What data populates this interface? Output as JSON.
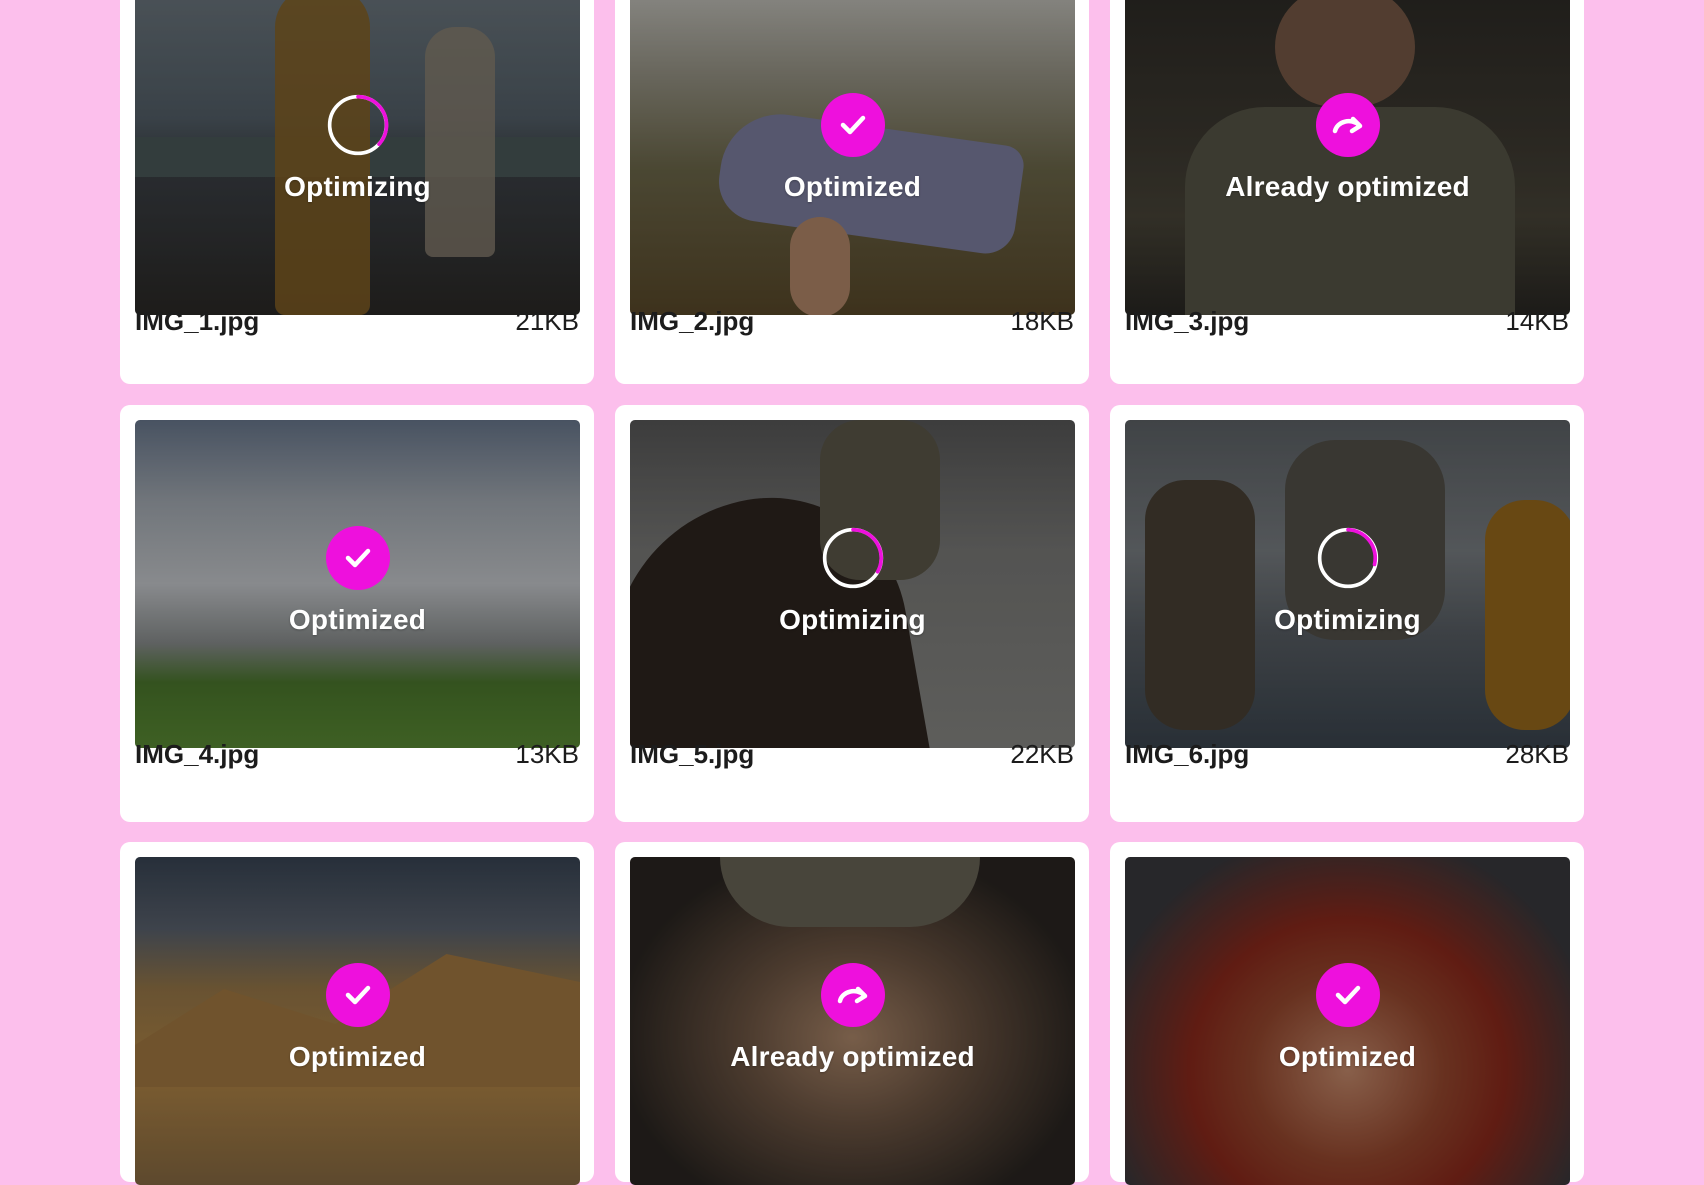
{
  "accent_color": "#ee10dd",
  "background_color": "#fcbfec",
  "images": [
    {
      "filename": "IMG_1.jpg",
      "size": "21KB",
      "status": "Optimizing",
      "icon": "progress-spinner-icon",
      "progress": 0.3
    },
    {
      "filename": "IMG_2.jpg",
      "size": "18KB",
      "status": "Optimized",
      "icon": "checkmark-icon"
    },
    {
      "filename": "IMG_3.jpg",
      "size": "14KB",
      "status": "Already optimized",
      "icon": "redo-arrow-icon"
    },
    {
      "filename": "IMG_4.jpg",
      "size": "13KB",
      "status": "Optimized",
      "icon": "checkmark-icon"
    },
    {
      "filename": "IMG_5.jpg",
      "size": "22KB",
      "status": "Optimizing",
      "icon": "progress-spinner-icon",
      "progress": 0.3
    },
    {
      "filename": "IMG_6.jpg",
      "size": "28KB",
      "status": "Optimizing",
      "icon": "progress-spinner-icon",
      "progress": 0.3
    },
    {
      "status": "Optimized",
      "icon": "checkmark-icon"
    },
    {
      "status": "Already optimized",
      "icon": "redo-arrow-icon"
    },
    {
      "status": "Optimized",
      "icon": "checkmark-icon"
    }
  ]
}
